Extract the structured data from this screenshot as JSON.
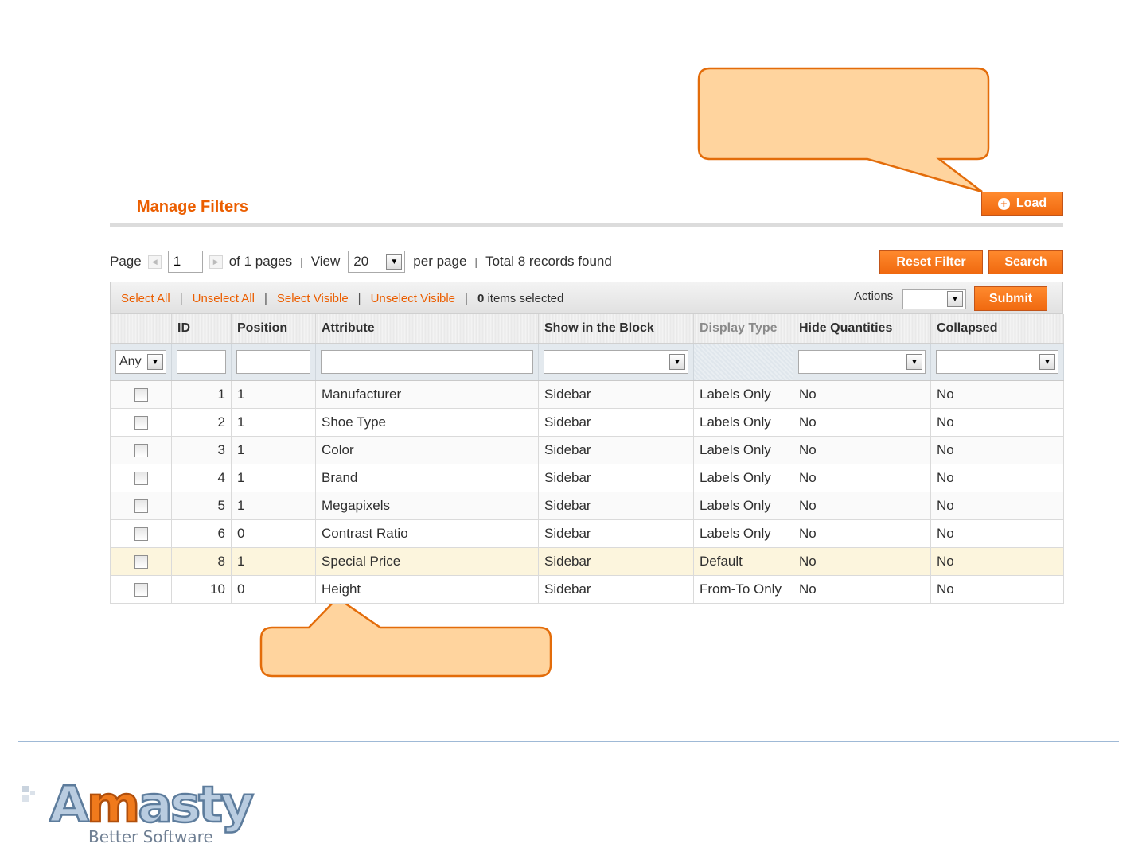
{
  "header": {
    "title": "Manage Filters",
    "load_label": "Load"
  },
  "pager": {
    "page_label": "Page",
    "page_value": "1",
    "of_pages": "of 1 pages",
    "view_label": "View",
    "view_value": "20",
    "per_page": "per page",
    "total": "Total 8 records found",
    "reset_label": "Reset Filter",
    "search_label": "Search"
  },
  "massaction": {
    "select_all": "Select All",
    "unselect_all": "Unselect All",
    "select_visible": "Select Visible",
    "unselect_visible": "Unselect Visible",
    "selected_count": "0",
    "selected_suffix": "items selected",
    "actions_label": "Actions",
    "submit_label": "Submit"
  },
  "grid": {
    "columns": [
      "",
      "ID",
      "Position",
      "Attribute",
      "Show in the Block",
      "Display Type",
      "Hide Quantities",
      "Collapsed"
    ],
    "filter_any": "Any",
    "rows": [
      {
        "id": "1",
        "position": "1",
        "attribute": "Manufacturer",
        "block": "Sidebar",
        "display": "Labels Only",
        "hide": "No",
        "collapsed": "No"
      },
      {
        "id": "2",
        "position": "1",
        "attribute": "Shoe Type",
        "block": "Sidebar",
        "display": "Labels Only",
        "hide": "No",
        "collapsed": "No"
      },
      {
        "id": "3",
        "position": "1",
        "attribute": "Color",
        "block": "Sidebar",
        "display": "Labels Only",
        "hide": "No",
        "collapsed": "No"
      },
      {
        "id": "4",
        "position": "1",
        "attribute": "Brand",
        "block": "Sidebar",
        "display": "Labels Only",
        "hide": "No",
        "collapsed": "No"
      },
      {
        "id": "5",
        "position": "1",
        "attribute": "Megapixels",
        "block": "Sidebar",
        "display": "Labels Only",
        "hide": "No",
        "collapsed": "No"
      },
      {
        "id": "6",
        "position": "0",
        "attribute": "Contrast Ratio",
        "block": "Sidebar",
        "display": "Labels Only",
        "hide": "No",
        "collapsed": "No"
      },
      {
        "id": "8",
        "position": "1",
        "attribute": "Special Price",
        "block": "Sidebar",
        "display": "Default",
        "hide": "No",
        "collapsed": "No"
      },
      {
        "id": "10",
        "position": "0",
        "attribute": "Height",
        "block": "Sidebar",
        "display": "From-To Only",
        "hide": "No",
        "collapsed": "No"
      }
    ]
  },
  "footer": {
    "logo_text": "Amasty",
    "tagline": "Better Software"
  },
  "colors": {
    "accent": "#eb5e00",
    "callout_fill": "#ffd49e",
    "callout_border": "#e36c0a",
    "footer_rule": "#9fb9d6"
  }
}
